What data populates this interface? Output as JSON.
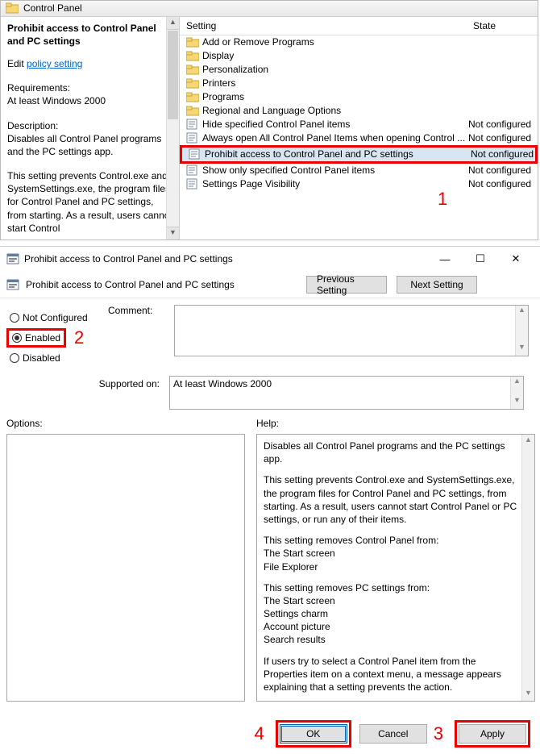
{
  "top": {
    "header": "Control Panel",
    "left": {
      "title": "Prohibit access to Control Panel and PC settings",
      "edit_prefix": "Edit ",
      "edit_link": "policy setting",
      "req_label": "Requirements:",
      "req_value": "At least Windows 2000",
      "desc_label": "Description:",
      "desc_1": "Disables all Control Panel programs and the PC settings app.",
      "desc_2": "This setting prevents Control.exe and SystemSettings.exe, the program files for Control Panel and PC settings, from starting. As a result, users cannot start Control"
    },
    "columns": {
      "setting": "Setting",
      "state": "State"
    },
    "rows": [
      {
        "type": "folder",
        "label": "Add or Remove Programs",
        "state": ""
      },
      {
        "type": "folder",
        "label": "Display",
        "state": ""
      },
      {
        "type": "folder",
        "label": "Personalization",
        "state": ""
      },
      {
        "type": "folder",
        "label": "Printers",
        "state": ""
      },
      {
        "type": "folder",
        "label": "Programs",
        "state": ""
      },
      {
        "type": "folder",
        "label": "Regional and Language Options",
        "state": ""
      },
      {
        "type": "setting",
        "label": "Hide specified Control Panel items",
        "state": "Not configured"
      },
      {
        "type": "setting",
        "label": "Always open All Control Panel Items when opening Control ...",
        "state": "Not configured"
      },
      {
        "type": "setting",
        "label": "Prohibit access to Control Panel and PC settings",
        "state": "Not configured",
        "selected": true,
        "boxed": true
      },
      {
        "type": "setting",
        "label": "Show only specified Control Panel items",
        "state": "Not configured"
      },
      {
        "type": "setting",
        "label": "Settings Page Visibility",
        "state": "Not configured"
      }
    ],
    "annot1": "1"
  },
  "dlg": {
    "title": "Prohibit access to Control Panel and PC settings",
    "subtitle": "Prohibit access to Control Panel and PC settings",
    "prev": "Previous Setting",
    "next": "Next Setting",
    "radios": {
      "not_configured": "Not Configured",
      "enabled": "Enabled",
      "disabled": "Disabled"
    },
    "annot2": "2",
    "comment_label": "Comment:",
    "supported_label": "Supported on:",
    "supported_value": "At least Windows 2000",
    "options_label": "Options:",
    "help_label": "Help:",
    "help_text": {
      "p1": "Disables all Control Panel programs and the PC settings app.",
      "p2": "This setting prevents Control.exe and SystemSettings.exe, the program files for Control Panel and PC settings, from starting. As a result, users cannot start Control Panel or PC settings, or run any of their items.",
      "p3": "This setting removes Control Panel from:",
      "p3a": "The Start screen",
      "p3b": "File Explorer",
      "p4": "This setting removes PC settings from:",
      "p4a": "The Start screen",
      "p4b": "Settings charm",
      "p4c": "Account picture",
      "p4d": "Search results",
      "p5": "If users try to select a Control Panel item from the Properties item on a context menu, a message appears explaining that a setting prevents the action."
    },
    "buttons": {
      "ok": "OK",
      "cancel": "Cancel",
      "apply": "Apply"
    },
    "annot3": "3",
    "annot4": "4"
  }
}
